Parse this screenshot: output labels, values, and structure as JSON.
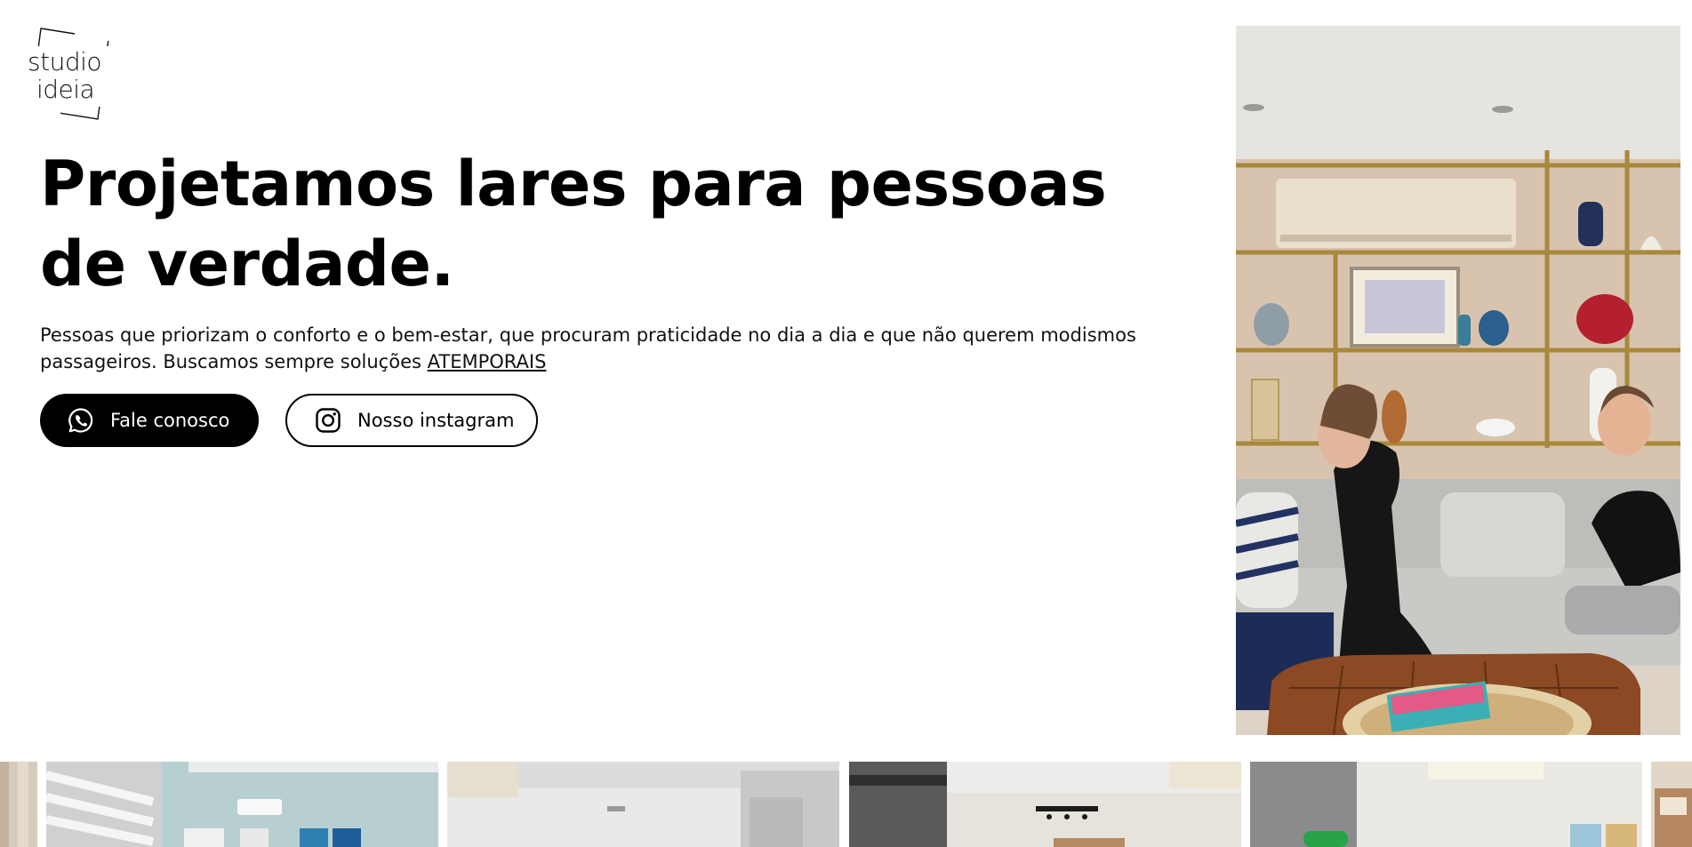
{
  "logo": {
    "line1": "studio",
    "line2": "ideia"
  },
  "hero": {
    "headline": "Projetamos lares para pessoas de verdade.",
    "description": "Pessoas que priorizam o conforto e o bem-estar, que procuram praticidade no dia a dia e que não querem modismos passageiros. Buscamos sempre soluções ",
    "description_link": "ATEMPORAIS"
  },
  "buttons": {
    "whatsapp": {
      "label": "Fale conosco",
      "icon": "whatsapp-icon"
    },
    "instagram": {
      "label": "Nosso instagram",
      "icon": "instagram-icon"
    }
  },
  "colors": {
    "primary": "#000000",
    "background": "#ffffff"
  }
}
